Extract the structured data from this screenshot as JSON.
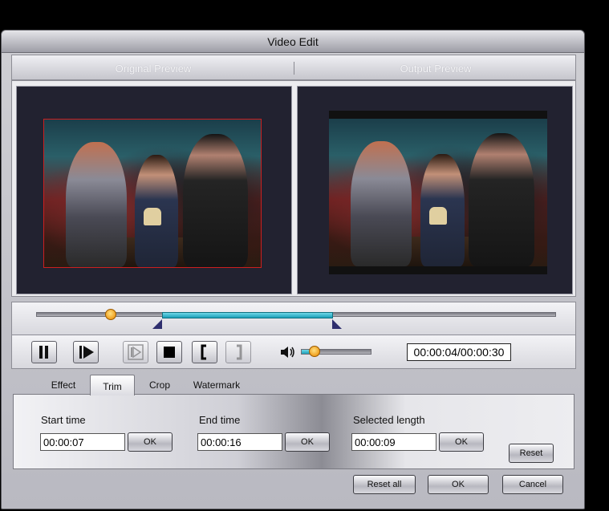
{
  "window": {
    "title": "Video Edit"
  },
  "preview": {
    "original_label": "Original Preview",
    "output_label": "Output Preview"
  },
  "timeline": {
    "position": 0.142,
    "selection_start": 0.24,
    "selection_end": 0.57
  },
  "playback": {
    "pause_icon": "pause-icon",
    "play_icon": "play-step-icon",
    "next_frame_icon": "next-frame-icon",
    "stop_icon": "stop-icon",
    "set_start_icon": "bracket-left-icon",
    "set_end_icon": "bracket-right-icon",
    "volume_icon": "speaker-icon",
    "volume_level": 0.18,
    "time_display": "00:00:04/00:00:30"
  },
  "tabs": [
    {
      "label": "Effect",
      "active": false
    },
    {
      "label": "Trim",
      "active": true
    },
    {
      "label": "Crop",
      "active": false
    },
    {
      "label": "Watermark",
      "active": false
    }
  ],
  "trim": {
    "start_label": "Start time",
    "start_value": "00:00:07",
    "end_label": "End time",
    "end_value": "00:00:16",
    "length_label": "Selected length",
    "length_value": "00:00:09",
    "ok_label": "OK",
    "reset_label": "Reset"
  },
  "footer": {
    "reset_all_label": "Reset all",
    "ok_label": "OK",
    "cancel_label": "Cancel"
  },
  "colors": {
    "selection": "#1b9fb8",
    "thumb": "#f0a020",
    "original_frame_border": "#cc1f1f"
  }
}
